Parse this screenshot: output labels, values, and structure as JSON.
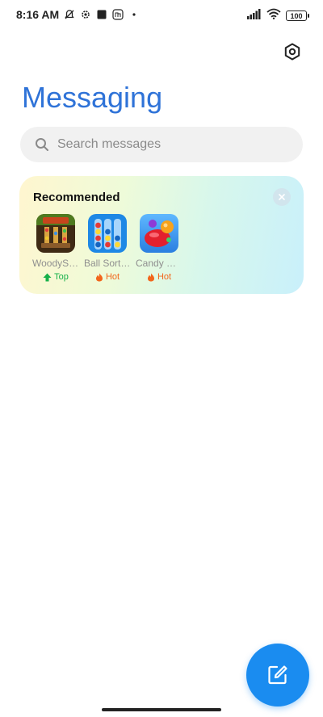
{
  "status_bar": {
    "time": "8:16 AM",
    "battery": "100",
    "left_icons": [
      "mute-bell-icon",
      "settings-gear-icon",
      "square-icon",
      "mi-icon",
      "dot-icon"
    ],
    "right_icons": [
      "signal-icon",
      "wifi-icon",
      "battery-icon"
    ]
  },
  "header": {
    "title": "Messaging",
    "settings_icon": "settings-icon"
  },
  "search": {
    "placeholder": "Search messages",
    "icon": "search-icon"
  },
  "recommended": {
    "title": "Recommended",
    "close_icon": "close-icon",
    "apps": [
      {
        "name": "WoodySort",
        "badge": "Top",
        "badge_type": "top",
        "badge_color": "#16b04a"
      },
      {
        "name": "Ball Sort: Color",
        "badge": "Hot",
        "badge_type": "hot",
        "badge_color": "#f2661c"
      },
      {
        "name": "Candy Crush",
        "badge": "Hot",
        "badge_type": "hot",
        "badge_color": "#f2661c"
      }
    ]
  },
  "fab": {
    "icon": "compose-icon",
    "color": "#1a8cf0"
  },
  "colors": {
    "accent": "#2f73d8",
    "fab": "#1a8cf0"
  }
}
